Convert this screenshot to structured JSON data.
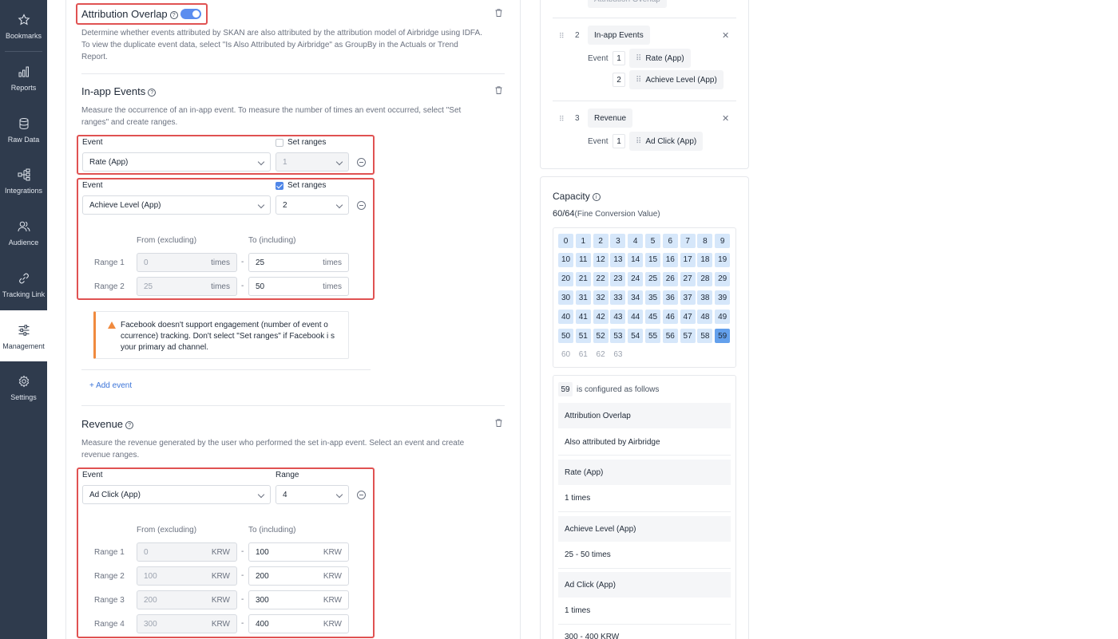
{
  "sidebar": {
    "items": [
      {
        "label": "Bookmarks",
        "icon": "star-icon"
      },
      {
        "label": "Reports",
        "icon": "chart-icon"
      },
      {
        "label": "Raw Data",
        "icon": "database-icon"
      },
      {
        "label": "Integrations",
        "icon": "integrations-icon"
      },
      {
        "label": "Audience",
        "icon": "people-icon"
      },
      {
        "label": "Tracking Link",
        "icon": "link-icon"
      },
      {
        "label": "Management",
        "icon": "sliders-icon",
        "active": true
      },
      {
        "label": "Settings",
        "icon": "gear-icon"
      }
    ]
  },
  "attribution": {
    "title": "Attribution Overlap",
    "enabled": true,
    "desc1": "Determine whether events attributed by SKAN are also attributed by the attribution model of Airbridge using IDFA.",
    "desc2": "To view the duplicate event data, select \"Is Also Attributed by Airbridge\" as GroupBy in the Actuals or Trend",
    "desc3": "Report."
  },
  "inapp": {
    "title": "In-app Events",
    "desc1": "Measure the occurrence of an in-app event. To measure the number of times an event occurred, select \"Set",
    "desc2": "ranges\" and create ranges.",
    "event_label": "Event",
    "set_ranges_label": "Set ranges",
    "events": [
      {
        "name": "Rate (App)",
        "set_ranges": false,
        "count": "1"
      },
      {
        "name": "Achieve Level (App)",
        "set_ranges": true,
        "count": "2"
      }
    ],
    "from_label": "From (excluding)",
    "to_label": "To (including)",
    "ranges": [
      {
        "label": "Range 1",
        "from": "0",
        "to": "25",
        "unit": "times"
      },
      {
        "label": "Range 2",
        "from": "25",
        "to": "50",
        "unit": "times"
      }
    ],
    "warning": "Facebook doesn't support engagement (number of event o ccurrence) tracking. Don't select \"Set ranges\" if Facebook i s your primary ad channel.",
    "add_event": "+ Add event"
  },
  "revenue": {
    "title": "Revenue",
    "desc1": "Measure the revenue generated by the user who performed the set in-app event. Select an event and create",
    "desc2": "revenue ranges.",
    "event_label": "Event",
    "range_label": "Range",
    "event": "Ad Click (App)",
    "range_count": "4",
    "from_label": "From (excluding)",
    "to_label": "To (including)",
    "ranges": [
      {
        "label": "Range 1",
        "from": "0",
        "to": "100",
        "unit": "KRW"
      },
      {
        "label": "Range 2",
        "from": "100",
        "to": "200",
        "unit": "KRW"
      },
      {
        "label": "Range 3",
        "from": "200",
        "to": "300",
        "unit": "KRW"
      },
      {
        "label": "Range 4",
        "from": "300",
        "to": "400",
        "unit": "KRW"
      }
    ]
  },
  "summary_list": {
    "top_cut_label": "Attribution Overlap",
    "groups": [
      {
        "num": "2",
        "title": "In-app Events",
        "event_label": "Event",
        "events": [
          {
            "n": "1",
            "name": "Rate (App)"
          },
          {
            "n": "2",
            "name": "Achieve Level (App)"
          }
        ]
      },
      {
        "num": "3",
        "title": "Revenue",
        "event_label": "Event",
        "events": [
          {
            "n": "1",
            "name": "Ad Click (App)"
          }
        ]
      }
    ]
  },
  "capacity": {
    "title": "Capacity",
    "used": "60/64",
    "unit_note": "(Fine Conversion Value)",
    "cells_total": 64,
    "cells_used": 60,
    "selected": "59",
    "configured_text": "is configured as follows",
    "config": [
      {
        "head": "Attribution Overlap",
        "value": "Also attributed by Airbridge"
      },
      {
        "head": "Rate (App)",
        "value": "1 times"
      },
      {
        "head": "Achieve Level (App)",
        "value": "25 - 50 times"
      },
      {
        "head": "Ad Click (App)",
        "value": "1 times"
      },
      {
        "head": "",
        "value": "300 - 400 KRW"
      }
    ]
  },
  "colors": {
    "accent": "#4f86e8",
    "highlight": "#e05252",
    "sidebar": "#2f3b4d",
    "cell": "#d6e7fa",
    "cell_selected": "#63a0ec",
    "warning": "#f08a3e"
  }
}
